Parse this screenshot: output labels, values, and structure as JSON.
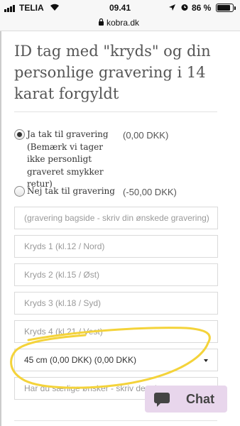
{
  "status_bar": {
    "carrier": "TELIA",
    "time": "09.41",
    "battery": "86 %",
    "battery_level": 0.86
  },
  "browser": {
    "url": "kobra.dk"
  },
  "product": {
    "title": "ID tag med \"kryds\" og din personlige gravering i 14 karat forgyldt"
  },
  "engraving_options": [
    {
      "label": "Ja tak til gravering (Bemærk vi tager ikke personligt graveret smykker retur)",
      "price": "(0,00 DKK)",
      "checked": true
    },
    {
      "label": "Nej tak til gravering",
      "price": "(-50,00 DKK)",
      "checked": false
    }
  ],
  "fields": {
    "engraving_back": "(gravering bagside - skriv din ønskede gravering)",
    "kryds1": "Kryds 1 (kl.12 / Nord)",
    "kryds2": "Kryds 2 (kl.15 / Øst)",
    "kryds3": "Kryds 3 (kl.18 / Syd)",
    "kryds4": "Kryds 4 (kl.21 / Vest)",
    "length_select": "45 cm (0,00 DKK) (0,00 DKK)",
    "special_wishes": "Har du særlige ønsker - skriv dem her"
  },
  "chat": {
    "label": "Chat",
    "bg": "#e8d6ec"
  },
  "annotation_color": "#f4d33a",
  "icons": [
    "signal-icon",
    "wifi-icon",
    "location-icon",
    "alarm-icon",
    "battery-icon",
    "lock-icon",
    "chat-bubble-icon",
    "dropdown-caret-icon"
  ]
}
